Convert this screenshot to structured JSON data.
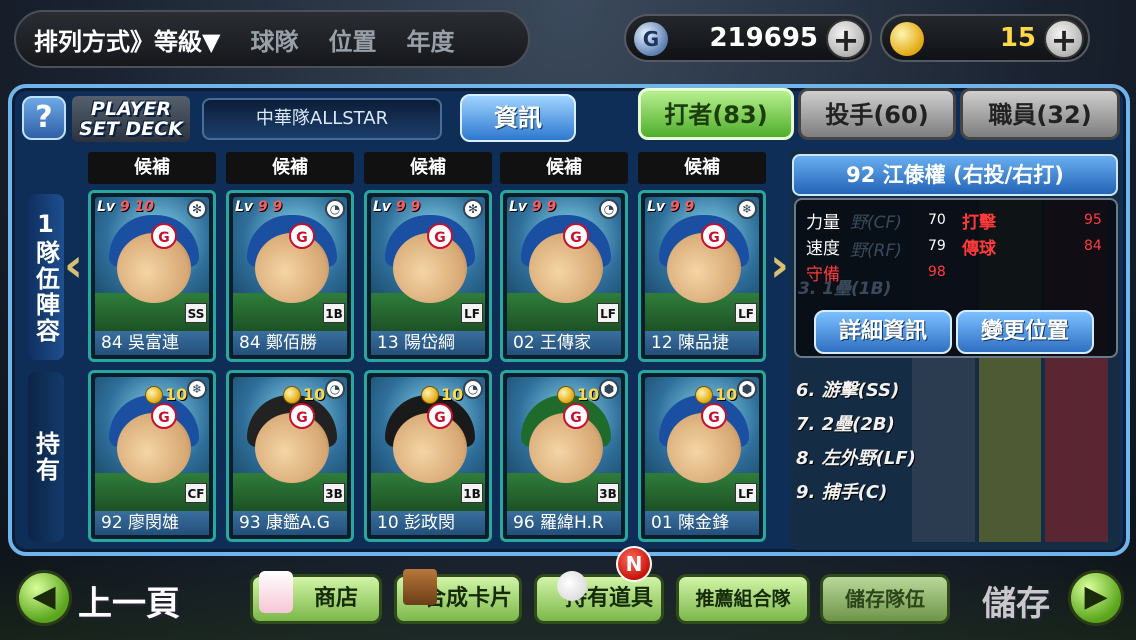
{
  "sort": {
    "label": "排列方式》等級",
    "caret": "▼",
    "options": [
      "球隊",
      "位置",
      "年度"
    ]
  },
  "currency": {
    "gems": {
      "icon": "gem-icon",
      "symbol": "G",
      "value": "219695"
    },
    "coins": {
      "icon": "coin-icon",
      "value": "15"
    },
    "plus": "+"
  },
  "header": {
    "help": "?",
    "logo_line1": "PLAYER",
    "logo_line2": "SET DECK",
    "team": "中華隊ALLSTAR",
    "info_button": "資訊"
  },
  "tabs": [
    {
      "label": "打者(83)",
      "active": true
    },
    {
      "label": "投手(60)",
      "active": false
    },
    {
      "label": "職員(32)",
      "active": false
    }
  ],
  "side_tabs": {
    "top": "1隊伍陣容",
    "bottom": "持有"
  },
  "slot_label": "候補",
  "deck_cards": [
    {
      "lv": "Lv",
      "stars": "9 10",
      "pos": "SS",
      "caption": "84 吳富連",
      "helmet": "#1b4fa2",
      "type": "✻"
    },
    {
      "lv": "Lv",
      "stars": "9 9",
      "pos": "1B",
      "caption": "84 鄭佰勝",
      "helmet": "#1b4fa2",
      "type": "◔"
    },
    {
      "lv": "Lv",
      "stars": "9 9",
      "pos": "LF",
      "caption": "13 陽岱綱",
      "helmet": "#1b4fa2",
      "type": "✻"
    },
    {
      "lv": "Lv",
      "stars": "9 9",
      "pos": "LF",
      "caption": "02 王傳家",
      "helmet": "#1b4fa2",
      "type": "◔"
    },
    {
      "lv": "Lv",
      "stars": "9 9",
      "pos": "LF",
      "caption": "12 陳品捷",
      "helmet": "#1b4fa2",
      "type": "❄"
    }
  ],
  "owned_cards": [
    {
      "coin": "10",
      "pos": "CF",
      "caption": "92 廖閔雄",
      "helmet": "#1b4fa2",
      "type": "❄"
    },
    {
      "coin": "10",
      "pos": "3B",
      "caption": "93 康鑑A.G",
      "helmet": "#222222",
      "type": "◔"
    },
    {
      "coin": "10",
      "pos": "1B",
      "caption": "10 彭政閔",
      "helmet": "#1a1a1a",
      "type": "◔"
    },
    {
      "coin": "10",
      "pos": "3B",
      "caption": "96 羅緯H.R",
      "helmet": "#1f6b2c",
      "type": "⬢"
    },
    {
      "coin": "10",
      "pos": "LF",
      "caption": "01 陳金鋒",
      "helmet": "#1b4fa2",
      "type": "⬢"
    }
  ],
  "detail": {
    "title": "92 江傣權 (右投/右打)",
    "stats": [
      {
        "label": "力量",
        "value": "70",
        "color": "#ffffff"
      },
      {
        "label": "速度",
        "value": "79",
        "color": "#ffffff"
      },
      {
        "label": "守備",
        "value": "98",
        "color": "#ff3a3a"
      }
    ],
    "stats_right": [
      {
        "label": "打擊",
        "value": "95"
      },
      {
        "label": "傳球",
        "value": "84"
      }
    ],
    "ghost_lines": [
      "野(CF)",
      "野(RF)",
      "3. 1壘(1B)"
    ],
    "btn_detail": "詳細資訊",
    "btn_change": "變更位置"
  },
  "lineup": [
    "6. 游擊(SS)",
    "7. 2壘(2B)",
    "8. 左外野(LF)",
    "9. 捕手(C)"
  ],
  "bottom": {
    "prev_arrow": "◀",
    "prev_label": "上一頁",
    "shop": "商店",
    "compose": "合成卡片",
    "items": "持有道具",
    "notify": "N",
    "recommend": "推薦組合隊",
    "save_team": "儲存隊伍",
    "save_label": "儲存",
    "next_arrow": "▶"
  },
  "colors": {
    "accent_green": "#7bb84a",
    "accent_blue": "#2f6fc2",
    "card_border": "#2aa6a0",
    "stat_red": "#ff3a3a"
  }
}
